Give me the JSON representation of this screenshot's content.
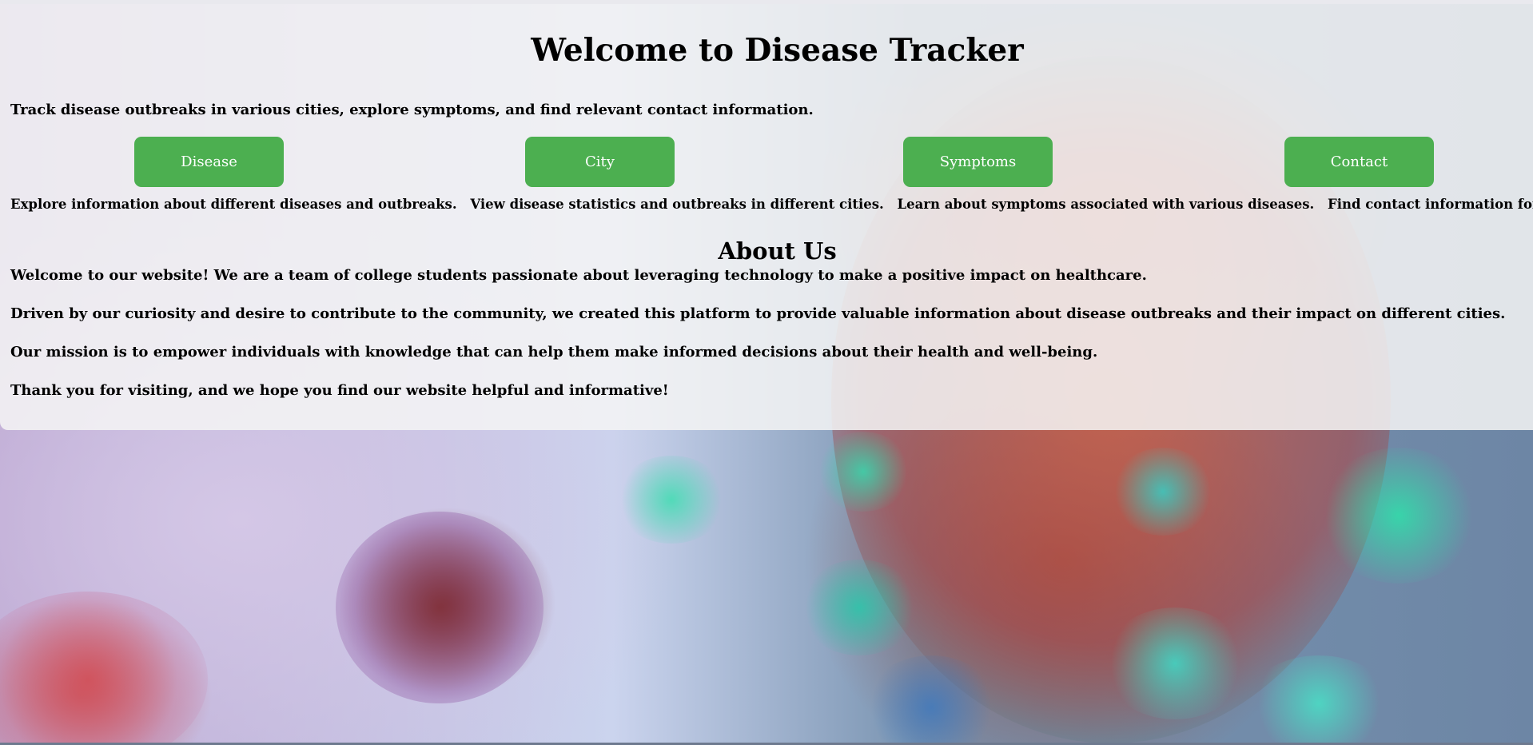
{
  "header": {
    "title": "Welcome to Disease Tracker",
    "intro": "Track disease outbreaks in various cities, explore symptoms, and find relevant contact information."
  },
  "nav": [
    {
      "label": "Disease",
      "description": "Explore information about different diseases and outbreaks."
    },
    {
      "label": "City",
      "description": "View disease statistics and outbreaks in different cities."
    },
    {
      "label": "Symptoms",
      "description": "Learn about symptoms associated with various diseases."
    },
    {
      "label": "Contact",
      "description": "Find contact information for relevant health authorities."
    }
  ],
  "about": {
    "heading": "About Us",
    "paragraphs": [
      "Welcome to our website! We are a team of college students passionate about leveraging technology to make a positive impact on healthcare.",
      "Driven by our curiosity and desire to contribute to the community, we created this platform to provide valuable information about disease outbreaks and their impact on different cities.",
      "Our mission is to empower individuals with knowledge that can help them make informed decisions about their health and well-being.",
      "Thank you for visiting, and we hope you find our website helpful and informative!"
    ]
  },
  "colors": {
    "button": "#4caf50",
    "button_text": "#ffffff",
    "panel": "#f5f5f5"
  }
}
